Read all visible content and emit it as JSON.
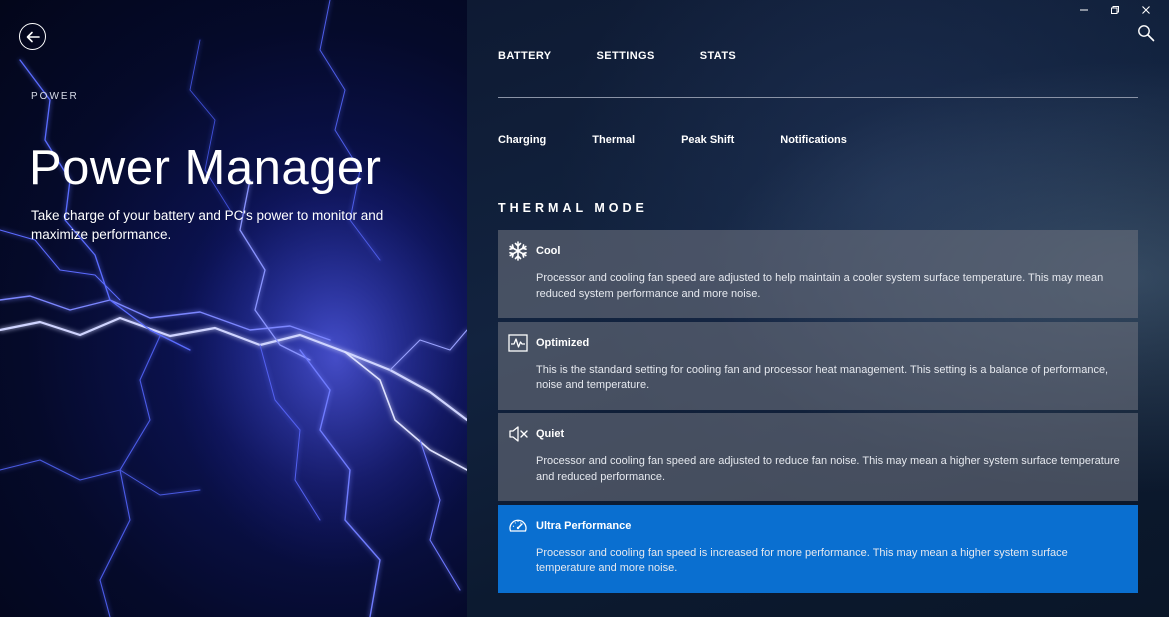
{
  "hero": {
    "eyebrow": "POWER",
    "title": "Power Manager",
    "description": "Take charge of your battery and PC's power to monitor and maximize performance."
  },
  "window_controls": {
    "minimize_icon": "minimize-icon",
    "restore_icon": "restore-icon",
    "close_icon": "close-icon"
  },
  "main_tabs": [
    {
      "label": "BATTERY"
    },
    {
      "label": "SETTINGS"
    },
    {
      "label": "STATS"
    }
  ],
  "sub_tabs": [
    {
      "label": "Charging"
    },
    {
      "label": "Thermal"
    },
    {
      "label": "Peak Shift"
    },
    {
      "label": "Notifications"
    }
  ],
  "section_title": "THERMAL MODE",
  "modes": [
    {
      "name": "Cool",
      "icon": "snowflake-icon",
      "selected": false,
      "description": "Processor and cooling fan speed are adjusted to help maintain a cooler system surface temperature. This may mean reduced system performance and more noise."
    },
    {
      "name": "Optimized",
      "icon": "pulse-monitor-icon",
      "selected": false,
      "description": "This is the standard setting for cooling fan and processor heat management. This setting is a balance of performance, noise and temperature."
    },
    {
      "name": "Quiet",
      "icon": "speaker-mute-icon",
      "selected": false,
      "description": "Processor and cooling fan speed are adjusted to reduce fan noise. This may mean a higher system surface temperature and reduced performance."
    },
    {
      "name": "Ultra Performance",
      "icon": "speedometer-icon",
      "selected": true,
      "description": "Processor and cooling fan speed is increased for more performance. This may mean a higher system surface temperature and more noise."
    }
  ],
  "colors": {
    "accent_selected": "#0a6fd0",
    "card_background": "#696e7a"
  }
}
